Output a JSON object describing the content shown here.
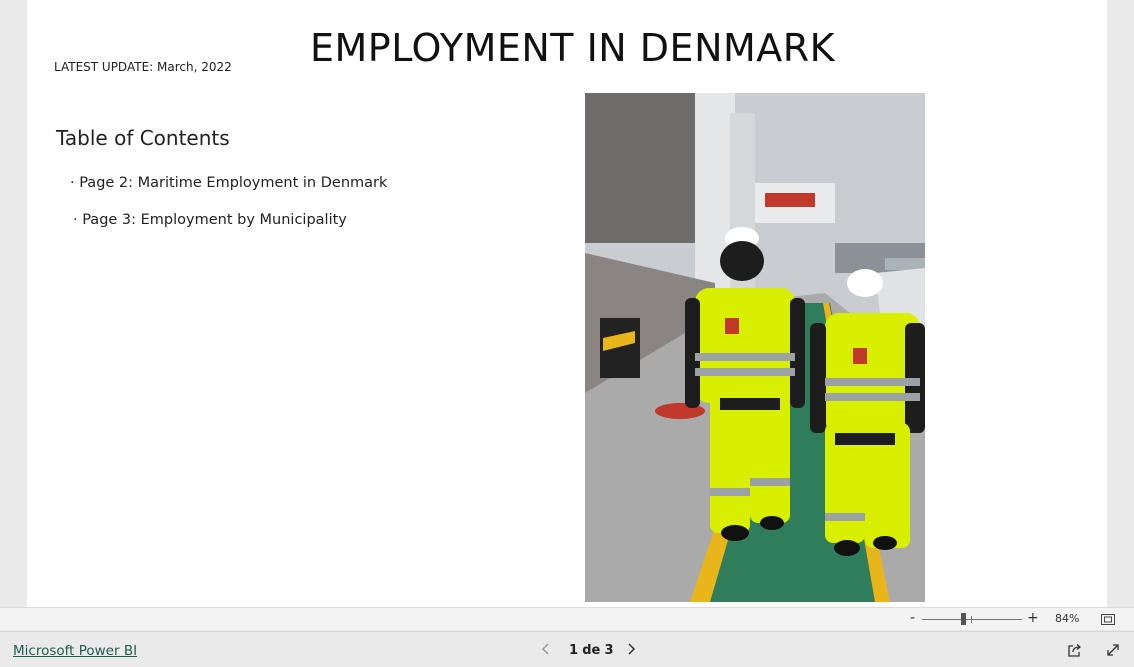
{
  "report": {
    "title": "EMPLOYMENT IN DENMARK",
    "latest_update": "LATEST UPDATE: March, 2022",
    "toc_title": "Table of Contents",
    "toc_items": [
      "· Page 2: Maritime Employment in Denmark",
      "· Page 3: Employment by Municipality"
    ]
  },
  "zoom": {
    "minus": "-",
    "plus": "+",
    "value": "84%",
    "level_percent": 84
  },
  "footer": {
    "brand_link": "Microsoft Power BI",
    "page_current": "1",
    "page_sep": "de",
    "page_total": "3"
  },
  "icons": {
    "prev": "chevron-left-icon",
    "next": "chevron-right-icon",
    "share": "share-icon",
    "expand": "expand-icon",
    "fit": "fit-to-page-icon"
  },
  "colors": {
    "canvas": "#ffffff",
    "chrome": "#eaeaea",
    "link": "#1e5d4c",
    "hi_vis": "#d8f000"
  }
}
